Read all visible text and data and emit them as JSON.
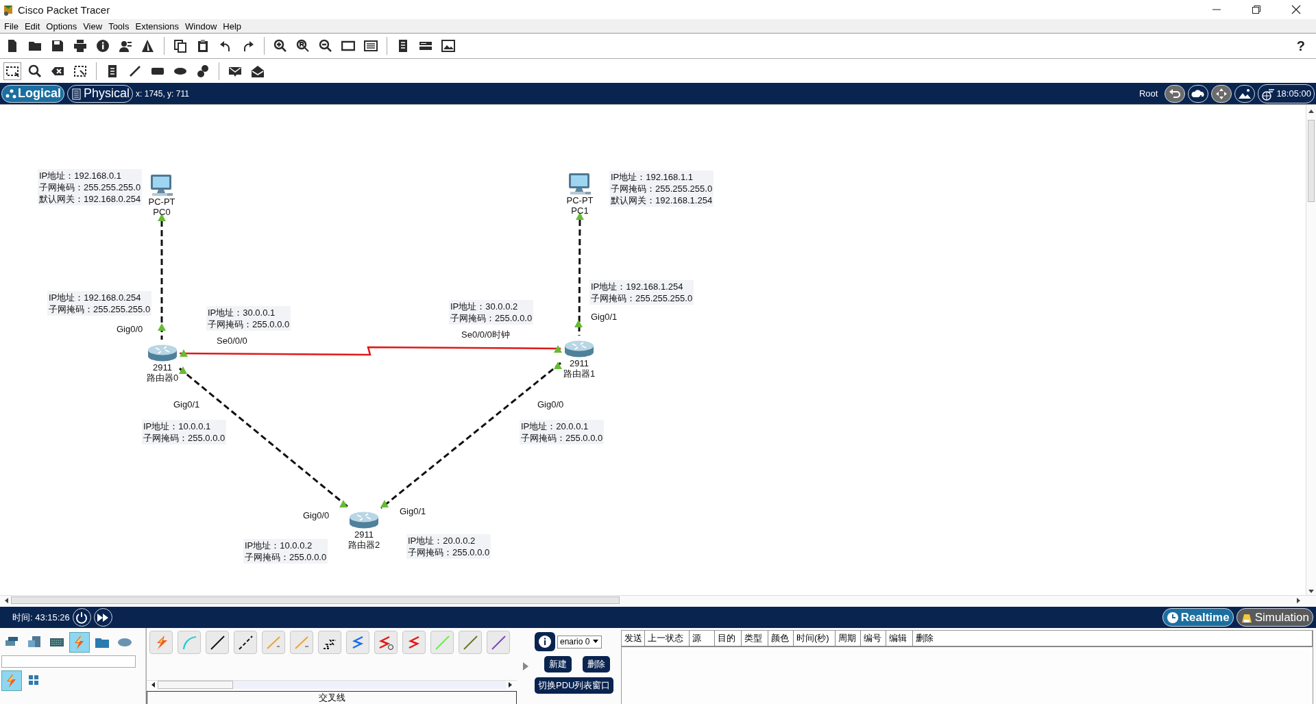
{
  "window": {
    "title": "Cisco Packet Tracer"
  },
  "menu": [
    "File",
    "Edit",
    "Options",
    "View",
    "Tools",
    "Extensions",
    "Window",
    "Help"
  ],
  "help": "?",
  "workspace_tabs": [
    {
      "label": "Logical",
      "selected": true
    },
    {
      "label": "Physical",
      "selected": false
    }
  ],
  "cursor_position": "x: 1745, y: 711",
  "root_label": "Root",
  "clock": "18:05:00",
  "devices": [
    {
      "kind": "pc",
      "model": "PC-PT",
      "name": "PC0"
    },
    {
      "kind": "pc",
      "model": "PC-PT",
      "name": "PC1"
    },
    {
      "kind": "router",
      "model": "2911",
      "name": "路由器0"
    },
    {
      "kind": "router",
      "model": "2911",
      "name": "路由器1"
    },
    {
      "kind": "router",
      "model": "2911",
      "name": "路由器2"
    }
  ],
  "links": [
    {
      "kind": "crossover",
      "up": true
    },
    {
      "kind": "crossover",
      "up": true
    },
    {
      "kind": "serial",
      "up": true
    },
    {
      "kind": "crossover",
      "up": true
    },
    {
      "kind": "crossover",
      "up": true
    }
  ],
  "notes": [
    {
      "lines": [
        "IP地址：192.168.0.1",
        "子网掩码：255.255.255.0",
        "默认网关：192.168.0.254"
      ]
    },
    {
      "lines": [
        "IP地址：192.168.1.1",
        "子网掩码：255.255.255.0",
        "默认网关：192.168.1.254"
      ]
    },
    {
      "lines": [
        "IP地址：192.168.1.254",
        "子网掩码：255.255.255.0"
      ]
    },
    {
      "lines": [
        "IP地址：192.168.0.254",
        "子网掩码：255.255.255.0"
      ]
    },
    {
      "lines": [
        "IP地址：30.0.0.2",
        "子网掩码：255.0.0.0"
      ]
    },
    {
      "lines": [
        "IP地址：30.0.0.1",
        "子网掩码：255.0.0.0"
      ]
    },
    {
      "lines": [
        "IP地址：10.0.0.1",
        "子网掩码：255.0.0.0"
      ]
    },
    {
      "lines": [
        "IP地址：20.0.0.1",
        "子网掩码：255.0.0.0"
      ]
    },
    {
      "lines": [
        "IP地址：20.0.0.2",
        "子网掩码：255.0.0.0"
      ]
    },
    {
      "lines": [
        "IP地址：10.0.0.2",
        "子网掩码：255.0.0.0"
      ]
    }
  ],
  "port_labels": [
    "Gig0/1",
    "Gig0/0",
    "Se0/0/0时钟",
    "Se0/0/0",
    "Gig0/1",
    "Gig0/0",
    "Gig0/1",
    "Gig0/0"
  ],
  "sim_time": "时间: 43:15:26",
  "mode_tabs": [
    {
      "label": "Realtime",
      "selected": true
    },
    {
      "label": "Simulation",
      "selected": false
    }
  ],
  "device_categories": [
    {
      "selected": false
    },
    {
      "selected": false
    },
    {
      "selected": false
    },
    {
      "selected": true
    },
    {
      "selected": false
    },
    {
      "selected": false
    }
  ],
  "device_subtypes": [
    {
      "selected": true
    },
    {
      "selected": false
    }
  ],
  "connection_caption": "交叉线",
  "scenario": {
    "value": "enario 0"
  },
  "pdu_buttons": [
    "新建",
    "删除"
  ],
  "pdu_toggle": "切换PDU列表窗口",
  "pdu_columns": [
    "发送",
    "上一状态",
    "源",
    "目的",
    "类型",
    "颜色",
    "时间(秒)",
    "周期",
    "编号",
    "编辑",
    "删除"
  ]
}
